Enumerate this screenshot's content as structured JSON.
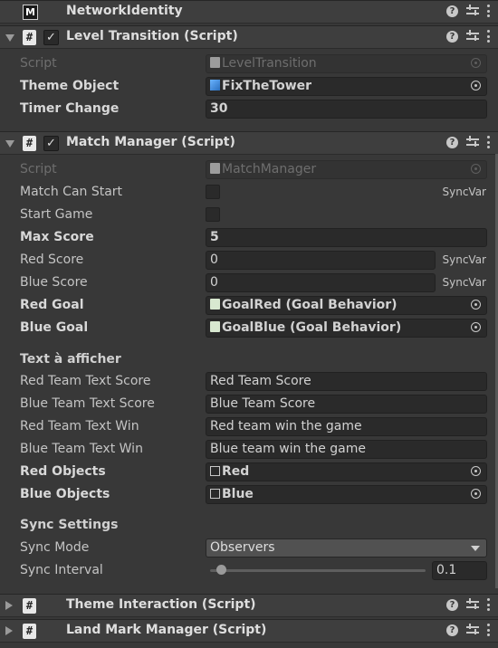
{
  "network_identity": {
    "title": "NetworkIdentity"
  },
  "level_transition": {
    "title": "Level Transition (Script)",
    "script_label": "Script",
    "script_value": "LevelTransition",
    "theme_object_label": "Theme Object",
    "theme_object_value": "FixTheTower",
    "timer_change_label": "Timer Change",
    "timer_change_value": "30"
  },
  "match_manager": {
    "title": "Match Manager (Script)",
    "script_label": "Script",
    "script_value": "MatchManager",
    "match_can_start_label": "Match Can Start",
    "start_game_label": "Start Game",
    "max_score_label": "Max Score",
    "max_score_value": "5",
    "red_score_label": "Red Score",
    "red_score_value": "0",
    "blue_score_label": "Blue Score",
    "blue_score_value": "0",
    "red_goal_label": "Red Goal",
    "red_goal_value": "GoalRed (Goal Behavior)",
    "blue_goal_label": "Blue Goal",
    "blue_goal_value": "GoalBlue (Goal Behavior)",
    "syncvar": "SyncVar",
    "text_section": "Text à afficher",
    "red_text_score_label": "Red Team Text Score",
    "red_text_score_value": "Red Team Score",
    "blue_text_score_label": "Blue Team Text Score",
    "blue_text_score_value": "Blue Team Score",
    "red_text_win_label": "Red Team Text Win",
    "red_text_win_value": "Red team win the game",
    "blue_text_win_label": "Blue Team Text Win",
    "blue_text_win_value": "Blue team win the game",
    "red_objects_label": "Red Objects",
    "red_objects_value": "Red",
    "blue_objects_label": "Blue Objects",
    "blue_objects_value": "Blue",
    "sync_section": "Sync Settings",
    "sync_mode_label": "Sync Mode",
    "sync_mode_value": "Observers",
    "sync_interval_label": "Sync Interval",
    "sync_interval_value": "0.1",
    "sync_interval_fraction": 0.05
  },
  "theme_interaction": {
    "title": "Theme Interaction (Script)"
  },
  "land_mark_manager": {
    "title": "Land Mark Manager (Script)"
  },
  "colors": {
    "background": "#383838",
    "header": "#3e3e3e",
    "field": "#2a2a2a"
  }
}
